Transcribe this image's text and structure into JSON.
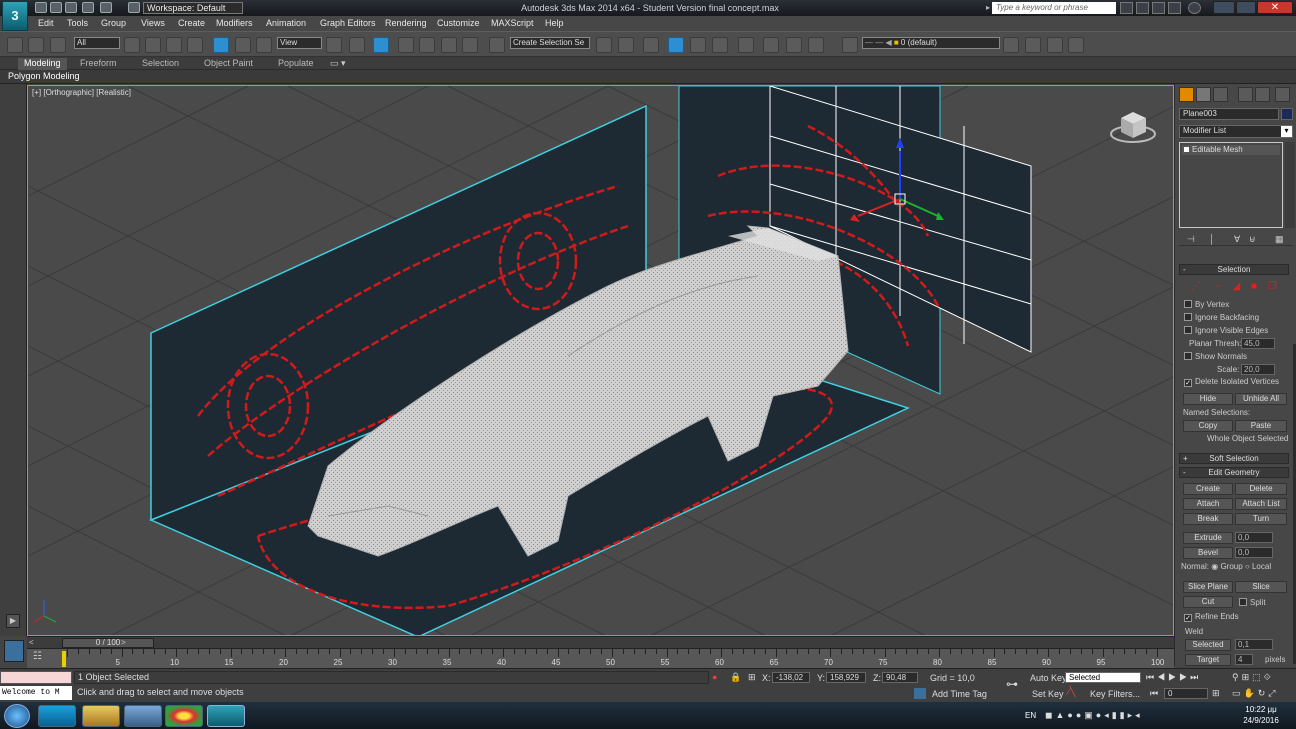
{
  "titlebar": {
    "workspace": "Workspace: Default",
    "title": "Autodesk 3ds Max  2014 x64  - Student Version   final concept.max",
    "search_placeholder": "Type a keyword or phrase"
  },
  "menu": [
    "Edit",
    "Tools",
    "Group",
    "Views",
    "Create",
    "Modifiers",
    "Animation",
    "Graph Editors",
    "Rendering",
    "Customize",
    "MAXScript",
    "Help"
  ],
  "toolbar": {
    "filter": "All",
    "ref_coord": "View",
    "sel_set": "Create Selection Se",
    "layer": "0 (default)"
  },
  "ribbon": {
    "tabs": [
      "Modeling",
      "Freeform",
      "Selection",
      "Object Paint",
      "Populate"
    ],
    "active": "Modeling",
    "panel_label": "Polygon Modeling"
  },
  "viewport": {
    "label": "[+] [Orthographic] [Realistic]"
  },
  "command_panel": {
    "object_name": "Plane003",
    "modifier_list": "Modifier List",
    "stack_item": "Editable Mesh",
    "selection": {
      "title": "Selection",
      "by_vertex": "By Vertex",
      "ignore_backfacing": "Ignore Backfacing",
      "ignore_visible_edges": "Ignore Visible Edges",
      "planar_thresh_label": "Planar Thresh:",
      "planar_thresh": "45,0",
      "show_normals": "Show Normals",
      "scale_label": "Scale:",
      "scale": "20,0",
      "delete_isolated": "Delete Isolated Vertices",
      "hide": "Hide",
      "unhide_all": "Unhide All",
      "named_selections": "Named Selections:",
      "copy": "Copy",
      "paste": "Paste",
      "whole_object": "Whole Object Selected"
    },
    "soft_selection": "Soft Selection",
    "edit_geometry": {
      "title": "Edit Geometry",
      "create": "Create",
      "delete": "Delete",
      "attach": "Attach",
      "attach_list": "Attach List",
      "break": "Break",
      "turn": "Turn",
      "extrude": "Extrude",
      "extrude_val": "0,0",
      "bevel": "Bevel",
      "bevel_val": "0,0",
      "normal_label": "Normal:",
      "group": "Group",
      "local": "Local",
      "slice_plane": "Slice Plane",
      "slice": "Slice",
      "cut": "Cut",
      "split": "Split",
      "refine_ends": "Refine Ends",
      "weld": "Weld",
      "selected": "Selected",
      "selected_val": "0,1",
      "target": "Target",
      "target_val": "4",
      "pixels": "pixels"
    }
  },
  "timeline": {
    "slider": "0 / 100",
    "ticks": [
      "5",
      "10",
      "15",
      "20",
      "25",
      "30",
      "35",
      "40",
      "45",
      "50",
      "55",
      "60",
      "65",
      "70",
      "75",
      "80",
      "85",
      "90",
      "95",
      "100"
    ]
  },
  "status": {
    "maxscript": "Welcome to M",
    "selected": "1 Object Selected",
    "prompt": "Click and drag to select and move objects",
    "x_label": "X:",
    "x": "-138,02",
    "y_label": "Y:",
    "y": "158,929",
    "z_label": "Z:",
    "z": "90,48",
    "grid": "Grid = 10,0",
    "add_time_tag": "Add Time Tag",
    "auto_key": "Auto Key",
    "set_key": "Set Key",
    "key_mode": "Selected",
    "key_filters": "Key Filters...",
    "frame": "0"
  },
  "taskbar": {
    "lang": "EN",
    "time": "10:22 μμ",
    "date": "24/9/2016"
  },
  "colors": {
    "accent": "#2e8fd0",
    "sketch": "#d11a1a",
    "plane_edge": "#3fd0e0"
  }
}
